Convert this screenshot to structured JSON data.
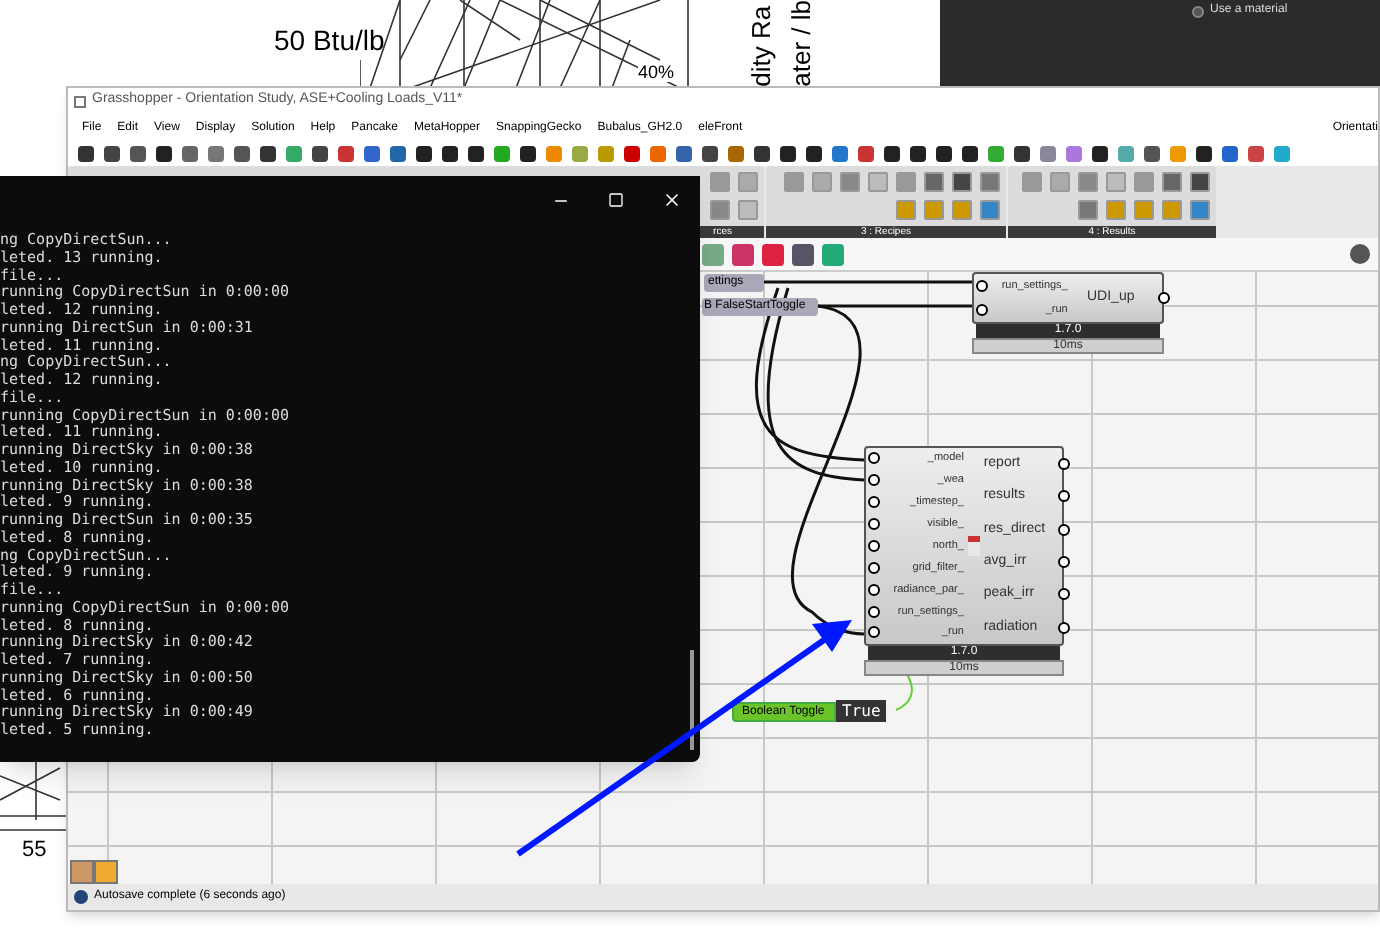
{
  "background_chart": {
    "labels": [
      "50 Btu/lb",
      "40%"
    ],
    "axis_title_lines": [
      "dity Ra",
      "ater / lb"
    ],
    "bottom_label": "55"
  },
  "material_panel": {
    "option": "Use a material",
    "selected": false
  },
  "window": {
    "title": "Grasshopper - Orientation Study, ASE+Cooling Loads_V11*"
  },
  "menu": [
    "File",
    "Edit",
    "View",
    "Display",
    "Solution",
    "Help",
    "Pancake",
    "MetaHopper",
    "SnappingGecko",
    "Bubalus_GH2.0",
    "eleFront"
  ],
  "menu_right": "Orientati",
  "ribbon_groups": [
    {
      "label": "rces"
    },
    {
      "label": "3 : Recipes"
    },
    {
      "label": "4 : Results"
    }
  ],
  "console": {
    "lines": [
      "ng CopyDirectSun...",
      "leted. 13 running.",
      "file...",
      "running CopyDirectSun in 0:00:00",
      "leted. 12 running.",
      "running DirectSun in 0:00:31",
      "leted. 11 running.",
      "ng CopyDirectSun...",
      "leted. 12 running.",
      "file...",
      "running CopyDirectSun in 0:00:00",
      "leted. 11 running.",
      "running DirectSky in 0:00:38",
      "leted. 10 running.",
      "running DirectSky in 0:00:38",
      "leted. 9 running.",
      "running DirectSun in 0:00:35",
      "leted. 8 running.",
      "ng CopyDirectSun...",
      "leted. 9 running.",
      "file...",
      "running CopyDirectSun in 0:00:00",
      "leted. 8 running.",
      "running DirectSky in 0:00:42",
      "leted. 7 running.",
      "running DirectSky in 0:00:50",
      "leted. 6 running.",
      "running DirectSky in 0:00:49",
      "leted. 5 running."
    ]
  },
  "canvas": {
    "params": [
      {
        "label": "ettings"
      },
      {
        "label": "B FalseStartToggle"
      }
    ],
    "nodes": [
      {
        "inputs": [
          "run_settings_",
          "_run"
        ],
        "outputs": [
          "UDI_up"
        ],
        "version": "1.7.0",
        "time": "10ms"
      },
      {
        "inputs": [
          "_model",
          "_wea",
          "_timestep_",
          "visible_",
          "north_",
          "grid_filter_",
          "radiance_par_",
          "run_settings_",
          "_run"
        ],
        "outputs": [
          "report",
          "results",
          "res_direct",
          "avg_irr",
          "peak_irr",
          "radiation"
        ],
        "version": "1.7.0",
        "time": "10ms"
      }
    ],
    "toggle": {
      "label": "Boolean Toggle",
      "value": "True"
    }
  },
  "status_bar": "Autosave complete (6 seconds ago)"
}
